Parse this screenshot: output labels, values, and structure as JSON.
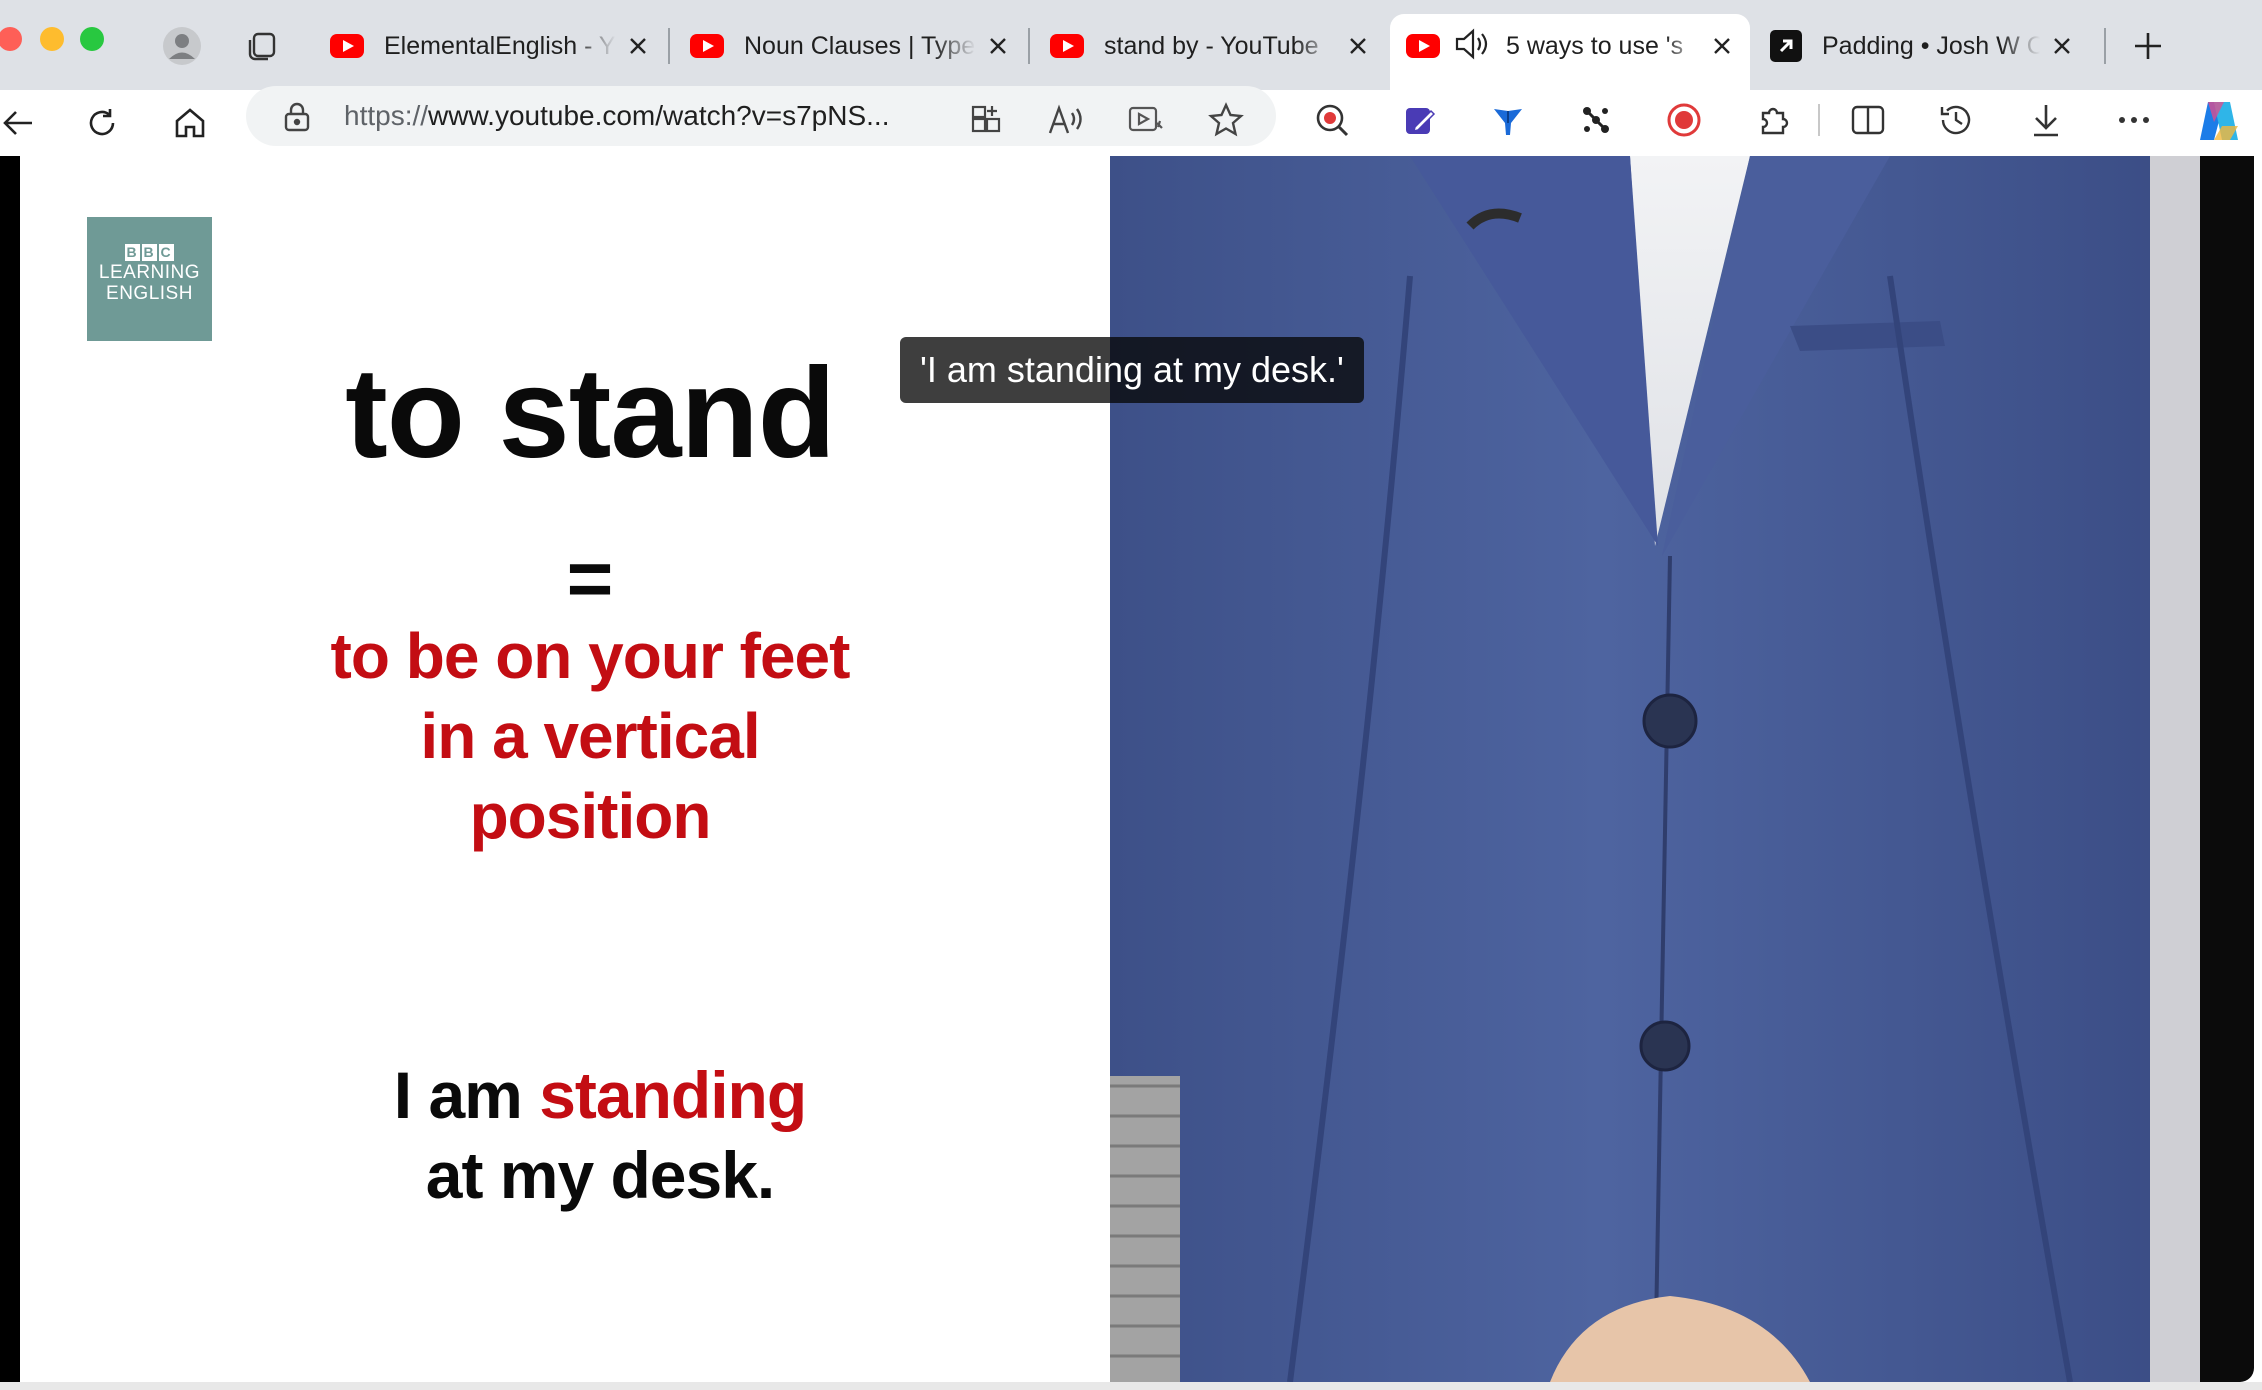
{
  "tabs": [
    {
      "title": "ElementalEnglish - Y",
      "favicon": "youtube-icon",
      "active": false
    },
    {
      "title": "Noun Clauses | Type",
      "favicon": "youtube-icon",
      "active": false
    },
    {
      "title": "stand by - YouTube",
      "favicon": "youtube-icon",
      "active": false
    },
    {
      "title": "5 ways to use 's",
      "favicon": "youtube-icon",
      "active": true,
      "audio": "speaker-icon"
    },
    {
      "title": "Padding • Josh W C",
      "favicon": "arrow-box-icon",
      "active": false
    }
  ],
  "address_bar": {
    "url_scheme": "https://",
    "url_rest": "www.youtube.com/watch?v=s7pNS..."
  },
  "video": {
    "logo": {
      "bbc": [
        "B",
        "B",
        "C"
      ],
      "line1": "LEARNING",
      "line2": "ENGLISH"
    },
    "headword": "to stand",
    "equals": "=",
    "definition_line1": "to be on your feet",
    "definition_line2": "in a vertical",
    "definition_line3": "position",
    "example_start": "I am ",
    "example_highlight": "standing",
    "example_end": "at my desk.",
    "caption": "'I am standing at my desk.'"
  },
  "colors": {
    "tabstrip_bg": "#dee1e6",
    "definition_red": "#c30d13",
    "logo_teal": "#6f9a96",
    "youtube_red": "#ff0000"
  }
}
